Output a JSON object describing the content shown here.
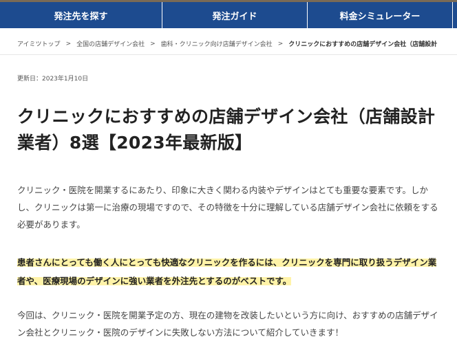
{
  "topnav": {
    "items": [
      {
        "label": "発注先を探す"
      },
      {
        "label": "発注ガイド"
      },
      {
        "label": "料金シミュレーター"
      }
    ],
    "bg_color": "#1d4b8f"
  },
  "breadcrumb": {
    "items": [
      "アイミツトップ",
      "全国の店舗デザイン会社",
      "歯科・クリニック向け店舗デザイン会社",
      "クリニックにおすすめの店舗デザイン会社（店舗設計"
    ],
    "separator": ">"
  },
  "updated": "更新日：2023年1月10日",
  "title": "クリニックにおすすめの店舗デザイン会社（店舗設計業者）8選【2023年最新版】",
  "paragraphs": {
    "intro": "クリニック・医院を開業するにあたり、印象に大きく関わる内装やデザインはとても重要な要素です。しかし、クリニックは第一に治療の現場ですので、その特徴を十分に理解している店舗デザイン会社に依頼をする必要があります。",
    "highlight": "患者さんにとっても働く人にとっても快適なクリニックを作るには、クリニックを専門に取り扱うデザイン業者や、医療現場のデザインに強い業者を外注先とするのがベストです。",
    "closing": "今回は、クリニック・医院を開業予定の方、現在の建物を改装したいという方に向け、おすすめの店舗デザイン会社とクリニック・医院のデザインに失敗しない方法について紹介していきます！"
  },
  "highlight_color": "#fff3a8"
}
